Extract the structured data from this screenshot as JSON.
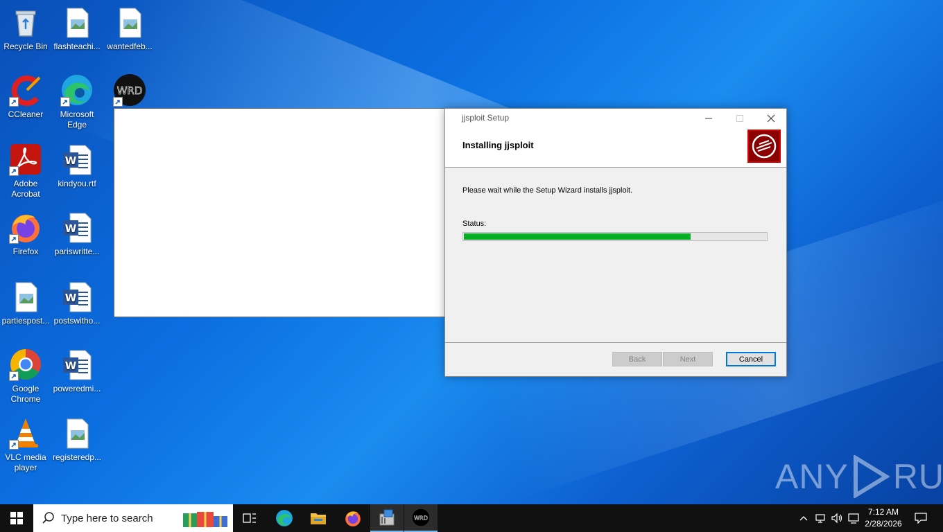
{
  "desktop": {
    "icons": [
      {
        "label": "Recycle Bin",
        "icon": "recycle-bin-icon"
      },
      {
        "label": "flashteachi...",
        "icon": "image-file-icon"
      },
      {
        "label": "wantedfeb...",
        "icon": "image-file-icon"
      },
      {
        "label": "CCleaner",
        "icon": "ccleaner-icon"
      },
      {
        "label": "Microsoft Edge",
        "icon": "edge-icon"
      },
      {
        "label": "Adobe Acrobat",
        "icon": "acrobat-icon"
      },
      {
        "label": "kindyou.rtf",
        "icon": "word-doc-icon"
      },
      {
        "label": "Firefox",
        "icon": "firefox-icon"
      },
      {
        "label": "pariswritte...",
        "icon": "word-doc-icon"
      },
      {
        "label": "partiespost...",
        "icon": "image-file-icon"
      },
      {
        "label": "postswitho...",
        "icon": "word-doc-icon"
      },
      {
        "label": "Google Chrome",
        "icon": "chrome-icon"
      },
      {
        "label": "poweredmi...",
        "icon": "word-doc-icon"
      },
      {
        "label": "VLC media player",
        "icon": "vlc-icon"
      },
      {
        "label": "registeredp...",
        "icon": "image-file-icon"
      }
    ]
  },
  "setup_dialog": {
    "title": "jjsploit Setup",
    "header_title": "Installing jjsploit",
    "body_text": "Please wait while the Setup Wizard installs jjsploit.",
    "status_label": "Status:",
    "progress_fraction": 0.75,
    "buttons": {
      "back": "Back",
      "next": "Next",
      "cancel": "Cancel"
    }
  },
  "watermark": {
    "left": "ANY",
    "right": "RUN"
  },
  "taskbar": {
    "search_placeholder": "Type here to search",
    "apps": [
      "task-view-icon",
      "edge-icon",
      "file-explorer-icon",
      "firefox-icon",
      "installer-icon",
      "wrd-app-icon"
    ]
  },
  "clock": {
    "time": "7:12 AM",
    "date": "2/28/2026"
  },
  "colors": {
    "progress": "#06b025",
    "accent": "#0078d7",
    "desktop": "#0b6ee0"
  }
}
